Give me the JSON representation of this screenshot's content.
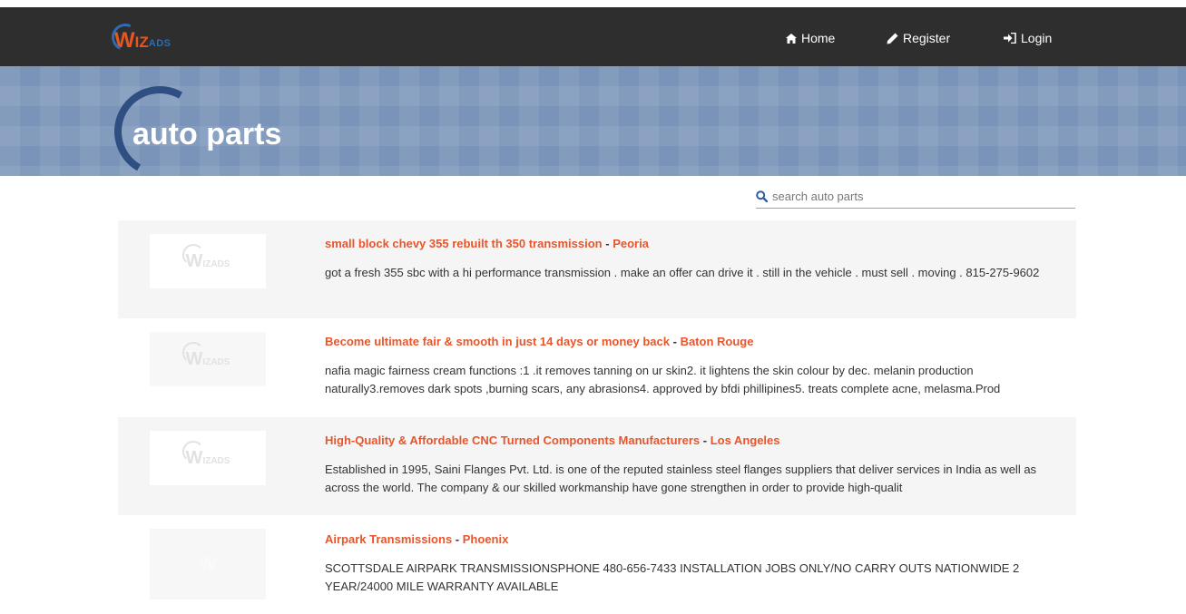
{
  "header": {
    "logo_text_w": "W",
    "logo_text_iz": "IZ",
    "logo_text_ads": "ADS",
    "nav": [
      {
        "label": "Home",
        "icon": "home-icon"
      },
      {
        "label": "Register",
        "icon": "pencil-icon"
      },
      {
        "label": "Login",
        "icon": "login-icon"
      }
    ]
  },
  "banner": {
    "title": "auto parts"
  },
  "search": {
    "placeholder": "search auto parts"
  },
  "thumb_logo": {
    "w": "W",
    "izads": "IZADS"
  },
  "listings": [
    {
      "title": "small block chevy 355 rebuilt th 350 transmission",
      "separator": " - ",
      "location": "Peoria",
      "description": "got a fresh 355 sbc with a hi performance transmission . make an offer can drive it . still in the vehicle . must sell . moving . 815-275-9602",
      "thumbnail": "placeholder"
    },
    {
      "title": "Become ultimate fair & smooth in just 14 days or money back",
      "separator": " - ",
      "location": "Baton Rouge",
      "description": "nafia magic fairness cream functions :1 .it removes tanning on ur skin2. it lightens the skin colour by dec. melanin production naturally3.removes dark spots ,burning scars, any abrasions4. approved by bfdi phillipines5. treats complete acne, melasma.Prod",
      "thumbnail": "placeholder"
    },
    {
      "title": "High-Quality & Affordable CNC Turned Components Manufacturers",
      "separator": " - ",
      "location": "Los Angeles",
      "description": "Established in 1995, Saini Flanges Pvt. Ltd. is one of the reputed stainless steel flanges suppliers that deliver services in India as well as across the world. The company & our skilled workmanship have gone strengthen in order to provide high-qualit",
      "thumbnail": "placeholder"
    },
    {
      "title": "Airpark Transmissions",
      "separator": " - ",
      "location": "Phoenix",
      "description": "SCOTTSDALE AIRPARK TRANSMISSIONSPHONE 480-656-7433 INSTALLATION JOBS ONLY/NO CARRY OUTS NATIONWIDE 2 YEAR/24000 MILE WARRANTY AVAILABLE",
      "thumbnail": "photo"
    }
  ],
  "colors": {
    "topbar": "#2e2e2e",
    "banner": "#7a93b8",
    "accent": "#e8552a",
    "brand_blue": "#2f6bb0"
  }
}
